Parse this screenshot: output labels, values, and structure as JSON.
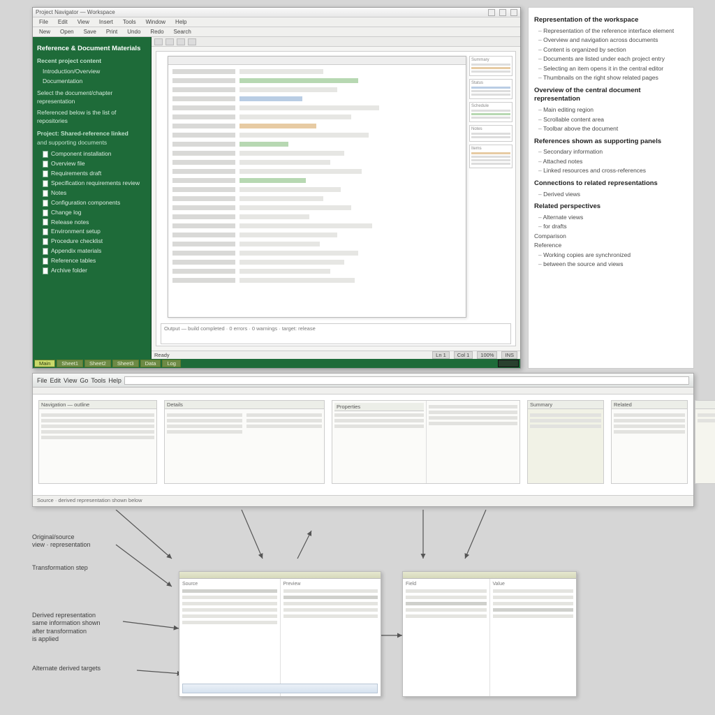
{
  "app": {
    "title": "Project Navigator — Workspace",
    "menu": [
      "File",
      "Edit",
      "View",
      "Insert",
      "Tools",
      "Window",
      "Help"
    ],
    "toolbar2": [
      "New",
      "Open",
      "Save",
      "Print",
      "Undo",
      "Redo",
      "Search"
    ]
  },
  "sidebar": {
    "heading": "Reference & Document Materials",
    "subheading": "Recent project content",
    "topLinks": [
      "Introduction/Overview",
      "Documentation"
    ],
    "note1": "Select the document/chapter representation",
    "note2": "Referenced below is the list of repositories",
    "sectionA_title": "Project: Shared-reference linked",
    "sectionA_sub": "and supporting documents",
    "docs": [
      "Component installation",
      "Overview file",
      "Requirements draft",
      "Specification requirements review",
      "Notes",
      "Configuration components",
      "Change log",
      "Release notes",
      "Environment setup",
      "Procedure checklist",
      "Appendix materials",
      "Reference tables",
      "Archive folder"
    ]
  },
  "thumbs": [
    {
      "title": "Summary"
    },
    {
      "title": "Status"
    },
    {
      "title": "Schedule"
    },
    {
      "title": "Notes"
    },
    {
      "title": "Items"
    }
  ],
  "console_text": "Output — build completed · 0 errors · 0 warnings · target: release",
  "statusbar": {
    "left": "Ready",
    "items": [
      "Ln 1",
      "Col 1",
      "100%",
      "INS"
    ]
  },
  "tabs": [
    "Main",
    "Sheet1",
    "Sheet2",
    "Sheet3",
    "Data",
    "Log"
  ],
  "right": {
    "h1": "Representation of the workspace",
    "p1": [
      "Representation of the reference interface element",
      "Overview and navigation across documents",
      "Content is organized by section"
    ],
    "p2": [
      "Documents are listed under each project entry",
      "Selecting an item opens it in the central editor",
      "Thumbnails on the right show related pages"
    ],
    "h2": "Overview of the central document representation",
    "p3": [
      "Main editing region",
      "Scrollable content area",
      "Toolbar above the document"
    ],
    "h3": "References shown as supporting panels",
    "p4": [
      "Secondary information",
      "Attached notes",
      "Linked resources and cross-references"
    ],
    "h4": "Connections to related representations",
    "p5": [
      "Derived views"
    ],
    "h5": "Related perspectives",
    "p6": [
      "Alternate views",
      "for drafts"
    ],
    "p7": [
      "Comparison"
    ],
    "p8": [
      "Reference"
    ],
    "p9": [
      "Working copies are synchronized",
      "between the source and views"
    ]
  },
  "strip": {
    "menu": [
      "File",
      "Edit",
      "View",
      "Go",
      "Tools",
      "Help"
    ],
    "cards": [
      {
        "title": "Navigation — outline"
      },
      {
        "title": "Details"
      },
      {
        "title": "Properties"
      },
      {
        "title": "Summary"
      },
      {
        "title": "Related"
      },
      {
        "title": ""
      }
    ],
    "footer": "Source · derived representation shown below"
  },
  "diagram": {
    "callout1_a": "Original/source",
    "callout1_b": "view · representation",
    "callout2": "Transformation step",
    "callout3_a": "Derived representation",
    "callout3_b": "same information shown",
    "callout3_c": "after transformation",
    "callout3_d": "is applied",
    "callout4": "Alternate derived targets",
    "miniA": {
      "colA": "Source",
      "colB": "Preview"
    },
    "miniB": {
      "colA": "Field",
      "colB": "Value"
    }
  }
}
